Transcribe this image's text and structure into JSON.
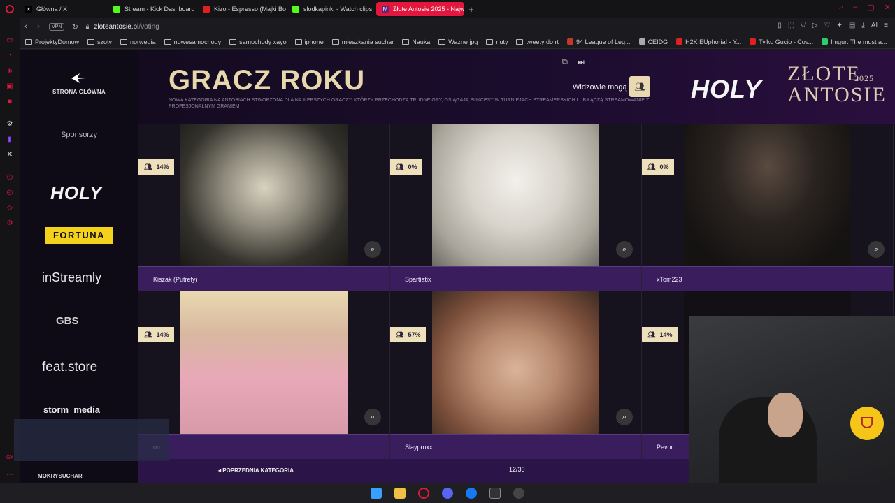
{
  "browser": {
    "tabs": [
      {
        "label": "Główna / X",
        "favicon": "x-icon",
        "active": false
      },
      {
        "label": "Stream - Kick Dashboard",
        "favicon": "kick-icon",
        "active": false
      },
      {
        "label": "Kizo - Espresso (Majki Bo",
        "favicon": "youtube-icon",
        "active": false
      },
      {
        "label": "slodkapinki - Watch clips",
        "favicon": "kick-icon",
        "active": false
      },
      {
        "label": "Złote Antosie 2025 - Najw",
        "favicon": "zlote-antosie-icon",
        "active": true
      }
    ],
    "url_host": "zloteantosie.pl",
    "url_path": "/voting",
    "vpn_label": "VPN",
    "ai_label": "AI",
    "bookmarks": [
      {
        "label": "ProjektyDomow",
        "type": "folder"
      },
      {
        "label": "szoty",
        "type": "folder"
      },
      {
        "label": "norwegia",
        "type": "folder"
      },
      {
        "label": "nowesamochody",
        "type": "folder"
      },
      {
        "label": "samochody xayo",
        "type": "folder"
      },
      {
        "label": "iphone",
        "type": "folder"
      },
      {
        "label": "mieszkania suchar",
        "type": "folder"
      },
      {
        "label": "Nauka",
        "type": "folder"
      },
      {
        "label": "Ważne jpg",
        "type": "folder"
      },
      {
        "label": "nuty",
        "type": "folder"
      },
      {
        "label": "tweety do rt",
        "type": "folder"
      },
      {
        "label": "94 League of Leg...",
        "type": "site"
      },
      {
        "label": "CEIDG",
        "type": "site"
      },
      {
        "label": "H2K EUphoria! - Y...",
        "type": "site"
      },
      {
        "label": "Tylko Gucio - Cov...",
        "type": "site"
      },
      {
        "label": "Imgur: The most a...",
        "type": "site"
      }
    ]
  },
  "site": {
    "home_label": "STRONA GŁÓWNA",
    "sponsors_title": "Sponsorzy",
    "sponsors": {
      "holy": "HOLY",
      "fortuna": "FORTUNA",
      "instreamly": "inStreamly",
      "gbs": "GBS",
      "feat": "feat.store",
      "storm": "storm_media",
      "mokry": "MOKRYSUCHAR"
    },
    "category_title": "GRACZ ROKU",
    "category_desc": "NOWA KATEGORIA NA ANTOSIACH STWORZONA DLA NAJLEPSZYCH GRACZY, KTÓRZY PRZECHODZĄ TRUDNE GRY, OSIĄGAJĄ SUKCESY W TURNIEJACH STREAMERSKICH LUB ŁĄCZĄ STREAMOWANIE Z PROFESJONALNYM GRANIEM",
    "viewers_label": "Widzowie mogą",
    "brand_holy": "HOLY",
    "brand_zlote_line1": "ZŁOTE",
    "brand_year": "2025",
    "brand_zlote_line2": "ANTOSIE",
    "nominees": [
      {
        "name": "Kiszak (Putrefy)",
        "percent": "14%"
      },
      {
        "name": "Spartiatix",
        "percent": "0%"
      },
      {
        "name": "xTom223",
        "percent": "0%"
      },
      {
        "name": "on",
        "percent": "14%"
      },
      {
        "name": "Slayproxx",
        "percent": "57%"
      },
      {
        "name": "Pevor",
        "percent": "14%"
      }
    ],
    "prev_category": "POPRZEDNIA KATEGORIA",
    "page_counter": "12/30"
  },
  "colors": {
    "accent_gold": "#ede0ba",
    "accent_purple": "#3a1d5c",
    "opera_red": "#e3173e"
  }
}
